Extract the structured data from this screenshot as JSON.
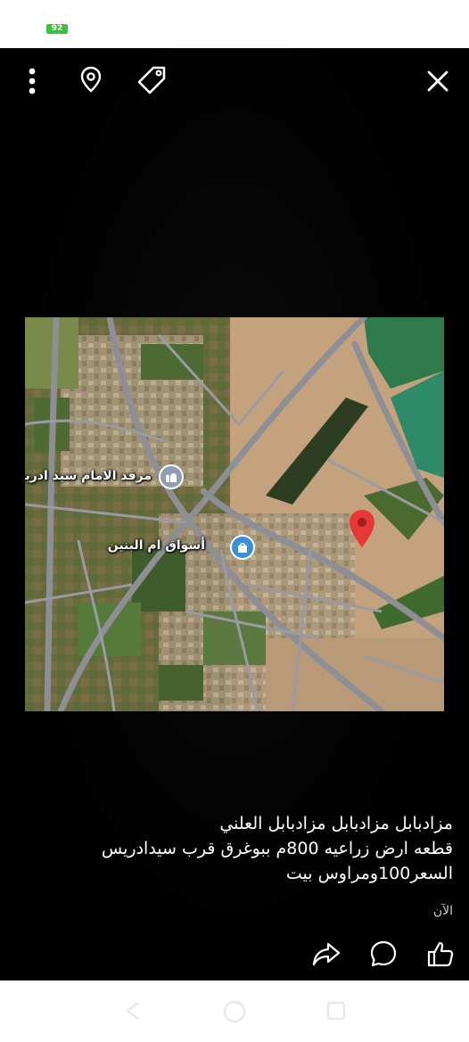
{
  "status_bar": {
    "battery_level": "92",
    "battery_color": "#3fbf3f"
  },
  "toolbar": {
    "menu_icon": "more-vertical-icon",
    "location_icon": "location-pin-icon",
    "tag_icon": "tag-icon",
    "close_icon": "close-icon"
  },
  "map": {
    "labels": [
      {
        "text": "مرقد الامام سيد ادريس",
        "poi_icon": "mosque-icon",
        "poi_color": "#8f9eb1"
      },
      {
        "text": "أسواق ام البنين",
        "poi_icon": "shopping-bag-icon",
        "poi_color": "#3b8fd9"
      }
    ],
    "pin_icon": "map-marker-icon",
    "pin_color": "#e53935"
  },
  "caption": {
    "lines": [
      "مزادبابل مزادبابل مزادبابل العلني",
      "قطعه ارض زراعيه 800م ببوغرق قرب سيدادريس",
      "السعر100ومراوس بيت"
    ]
  },
  "timestamp": "الآن",
  "actions": {
    "share_icon": "share-icon",
    "comment_icon": "comment-icon",
    "like_icon": "thumbs-up-icon"
  },
  "nav_bar": {
    "back_icon": "back-icon",
    "home_icon": "home-icon",
    "recents_icon": "recents-icon"
  }
}
